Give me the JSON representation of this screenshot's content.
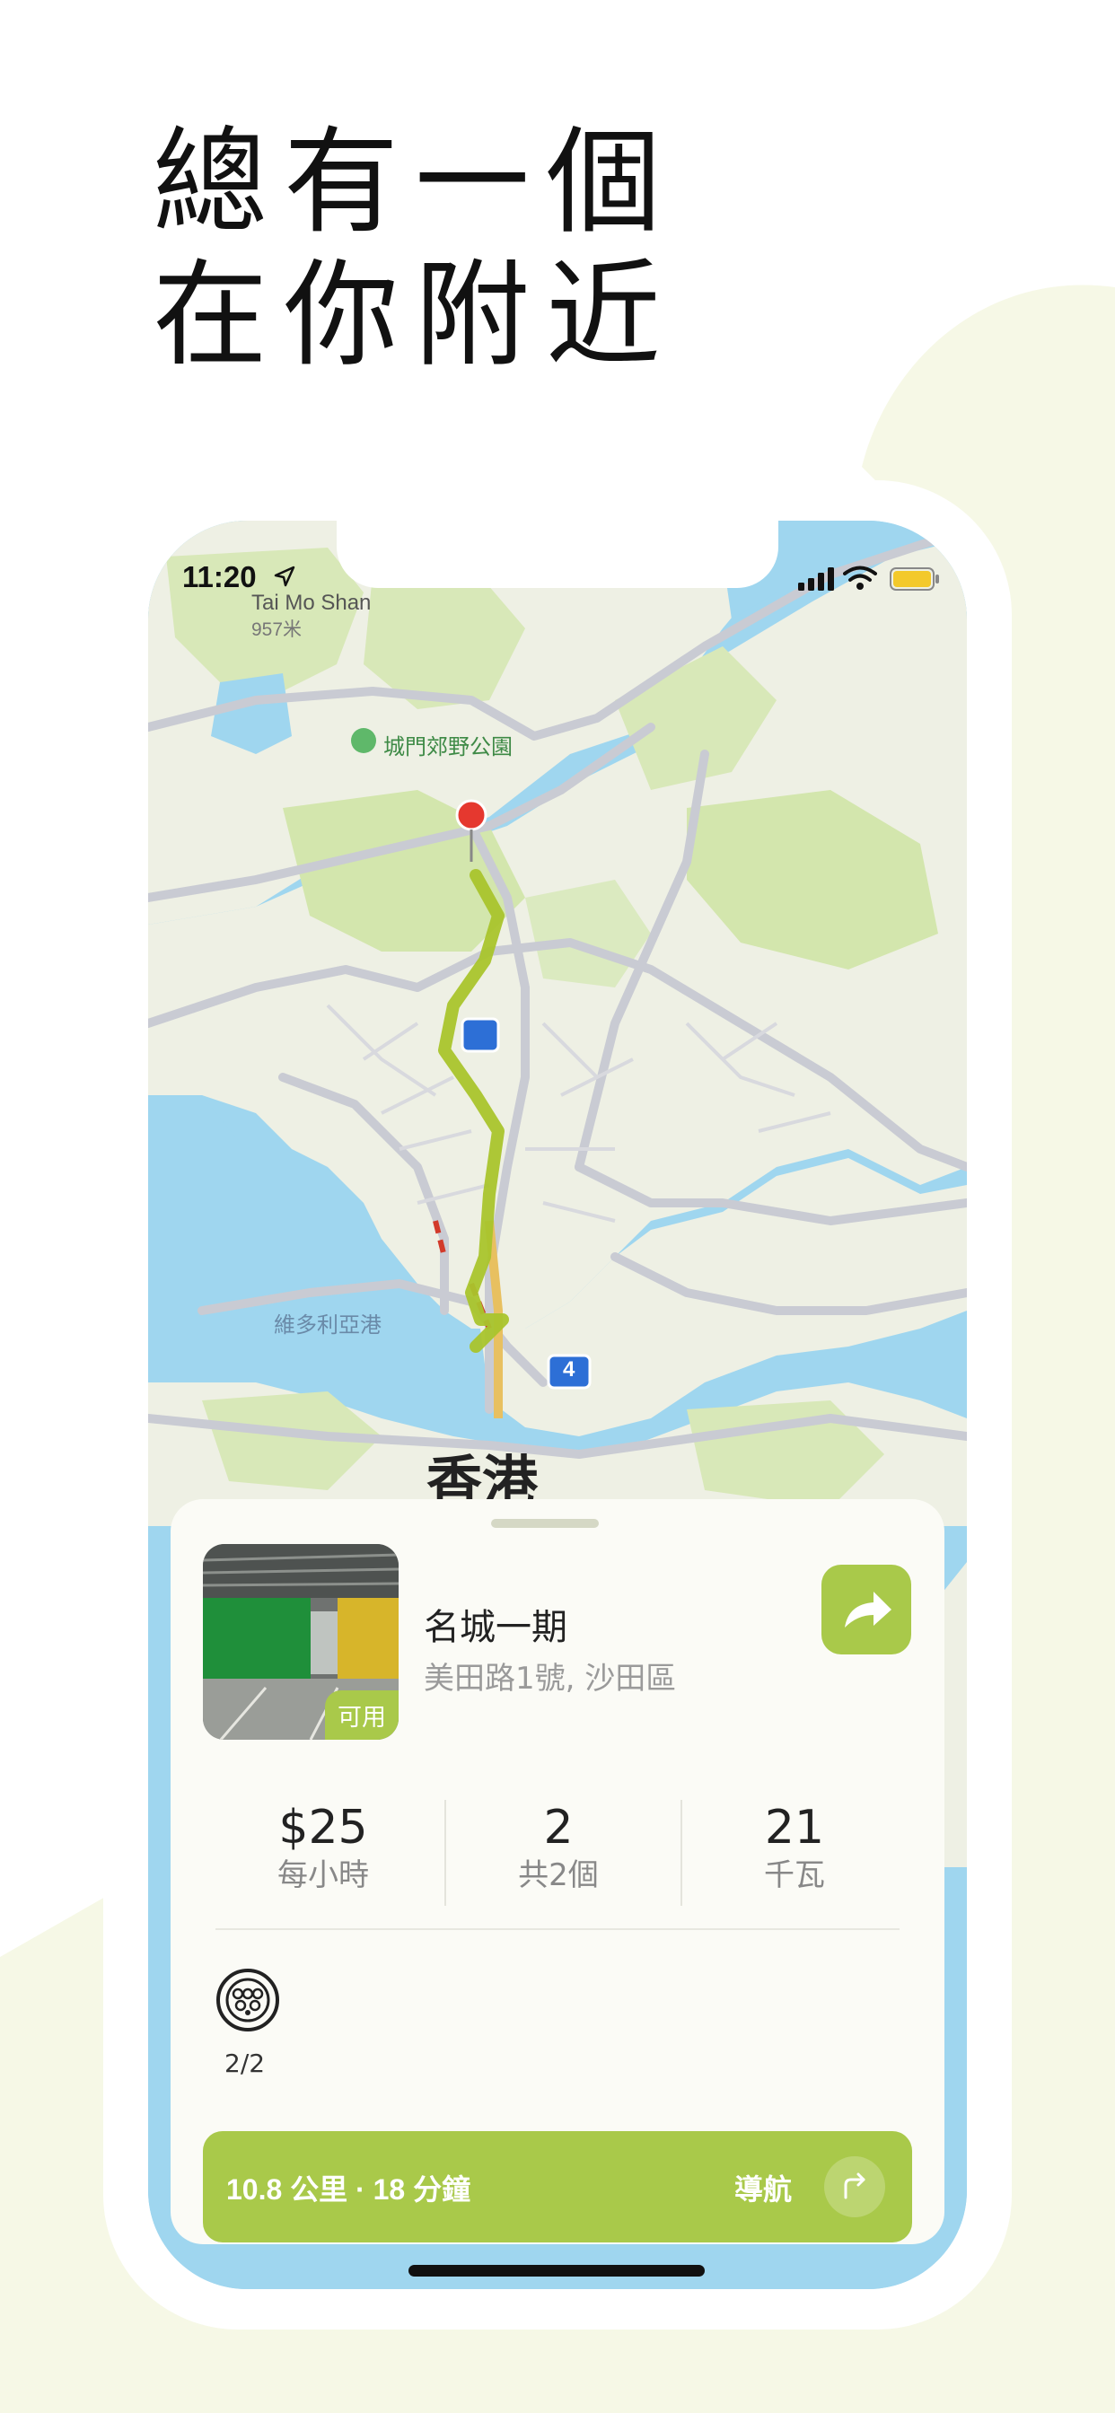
{
  "headline": {
    "line1": "總有一個",
    "line2": "在你附近"
  },
  "status_bar": {
    "time": "11:20"
  },
  "map": {
    "peak_name": "Tai Mo Shan",
    "peak_elevation": "957米",
    "park_label": "城門郊野公園",
    "harbour_label": "維多利亞港",
    "city_label": "香港",
    "route_shield": "4"
  },
  "station": {
    "name": "名城一期",
    "address": "美田路1號, 沙田區",
    "status_badge": "可用",
    "price": "$25",
    "price_label": "每小時",
    "chargers": "2",
    "chargers_label": "共2個",
    "power": "21",
    "power_label": "千瓦",
    "connector_availability": "2/2"
  },
  "navigation": {
    "distance_time": "10.8 公里 · 18 分鐘",
    "button_label": "導航"
  },
  "colors": {
    "accent": "#a9c94a",
    "background_blob": "#f6f8e6",
    "water": "#9fd6ef",
    "land": "#eef0e4",
    "route": "#a9c42c"
  }
}
